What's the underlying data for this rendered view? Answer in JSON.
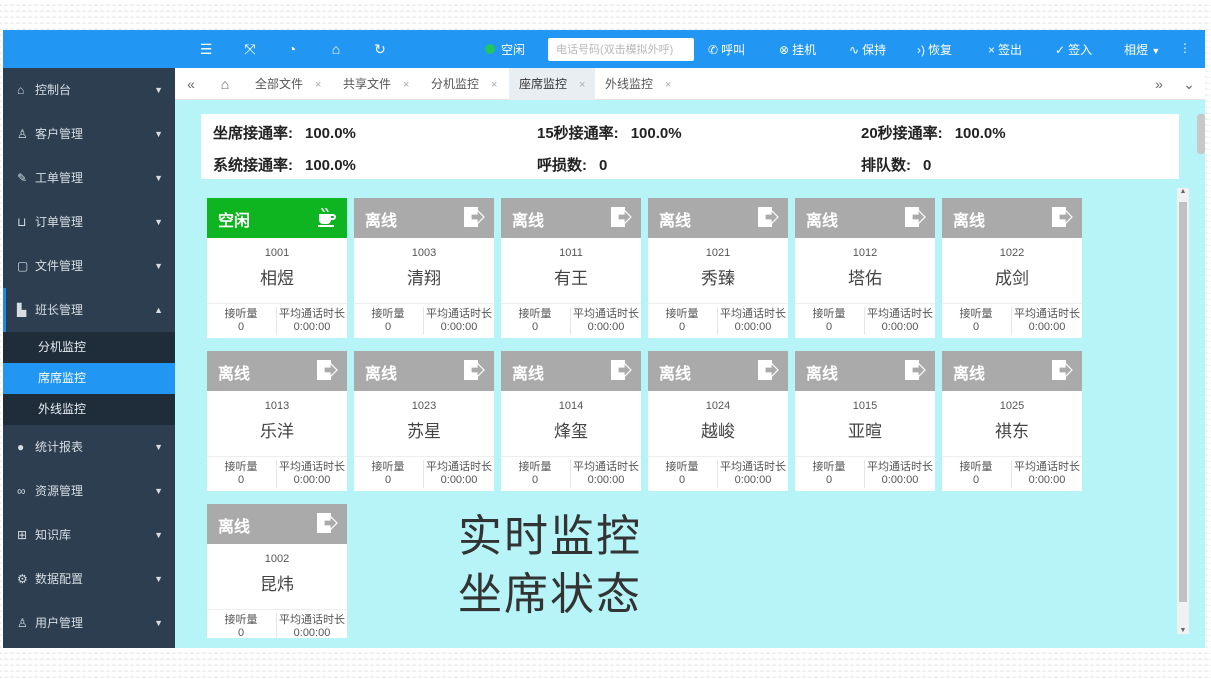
{
  "topbar": {
    "status": "空闲",
    "status_color": "#22c55e",
    "phone_placeholder": "电话号码(双击模拟外呼)",
    "actions": {
      "call": "呼叫",
      "hangup": "挂机",
      "hold": "保持",
      "resume": "恢复",
      "signout": "签出",
      "signin": "签入",
      "user": "相煜"
    },
    "icons": [
      "menu-icon",
      "fullscreen-icon",
      "theme-icon",
      "tag-icon",
      "refresh-icon"
    ]
  },
  "sidebar": {
    "items": [
      {
        "label": "控制台",
        "icon": "home-icon"
      },
      {
        "label": "客户管理",
        "icon": "user-icon"
      },
      {
        "label": "工单管理",
        "icon": "edit-icon"
      },
      {
        "label": "订单管理",
        "icon": "cart-icon"
      },
      {
        "label": "文件管理",
        "icon": "file-icon"
      },
      {
        "label": "班长管理",
        "icon": "chart-icon"
      },
      {
        "label": "统计报表",
        "icon": "pie-icon"
      },
      {
        "label": "资源管理",
        "icon": "link-icon"
      },
      {
        "label": "知识库",
        "icon": "book-icon"
      },
      {
        "label": "数据配置",
        "icon": "gear-icon"
      },
      {
        "label": "用户管理",
        "icon": "person-icon"
      }
    ],
    "subitems": [
      "分机监控",
      "席席监控",
      "外线监控"
    ]
  },
  "tabs": [
    {
      "label": "全部文件"
    },
    {
      "label": "共享文件"
    },
    {
      "label": "分机监控"
    },
    {
      "label": "座席监控"
    },
    {
      "label": "外线监控"
    }
  ],
  "stats": {
    "seat_rate_label": "坐席接通率:",
    "seat_rate": "100.0%",
    "rate15_label": "15秒接通率:",
    "rate15": "100.0%",
    "rate20_label": "20秒接通率:",
    "rate20": "100.0%",
    "sys_rate_label": "系统接通率:",
    "sys_rate": "100.0%",
    "lost_label": "呼损数:",
    "lost": "0",
    "queue_label": "排队数:",
    "queue": "0"
  },
  "card_labels": {
    "answered": "接听量",
    "avg_duration": "平均通话时长",
    "idle": "空闲",
    "offline": "离线"
  },
  "agents": [
    {
      "status": "空闲",
      "ext": "1001",
      "name": "相煜",
      "answered": "0",
      "avg": "0:00:00"
    },
    {
      "status": "离线",
      "ext": "1003",
      "name": "清翔",
      "answered": "0",
      "avg": "0:00:00"
    },
    {
      "status": "离线",
      "ext": "1011",
      "name": "有王",
      "answered": "0",
      "avg": "0:00:00"
    },
    {
      "status": "离线",
      "ext": "1021",
      "name": "秀臻",
      "answered": "0",
      "avg": "0:00:00"
    },
    {
      "status": "离线",
      "ext": "1012",
      "name": "塔佑",
      "answered": "0",
      "avg": "0:00:00"
    },
    {
      "status": "离线",
      "ext": "1022",
      "name": "成剑",
      "answered": "0",
      "avg": "0:00:00"
    },
    {
      "status": "离线",
      "ext": "1013",
      "name": "乐洋",
      "answered": "0",
      "avg": "0:00:00"
    },
    {
      "status": "离线",
      "ext": "1023",
      "name": "苏星",
      "answered": "0",
      "avg": "0:00:00"
    },
    {
      "status": "离线",
      "ext": "1014",
      "name": "烽玺",
      "answered": "0",
      "avg": "0:00:00"
    },
    {
      "status": "离线",
      "ext": "1024",
      "name": "越峻",
      "answered": "0",
      "avg": "0:00:00"
    },
    {
      "status": "离线",
      "ext": "1015",
      "name": "亚暄",
      "answered": "0",
      "avg": "0:00:00"
    },
    {
      "status": "离线",
      "ext": "1025",
      "name": "祺东",
      "answered": "0",
      "avg": "0:00:00"
    },
    {
      "status": "离线",
      "ext": "1002",
      "name": "昆炜",
      "answered": "0",
      "avg": "0:00:00"
    }
  ],
  "caption": {
    "line1": "实时监控",
    "line2": "坐席状态"
  },
  "colors": {
    "topbar": "#2196f3",
    "sidebar": "#2c3e50",
    "content_bg": "#b6f4f8",
    "idle": "#0eb520",
    "offline": "#aaaaaa"
  }
}
